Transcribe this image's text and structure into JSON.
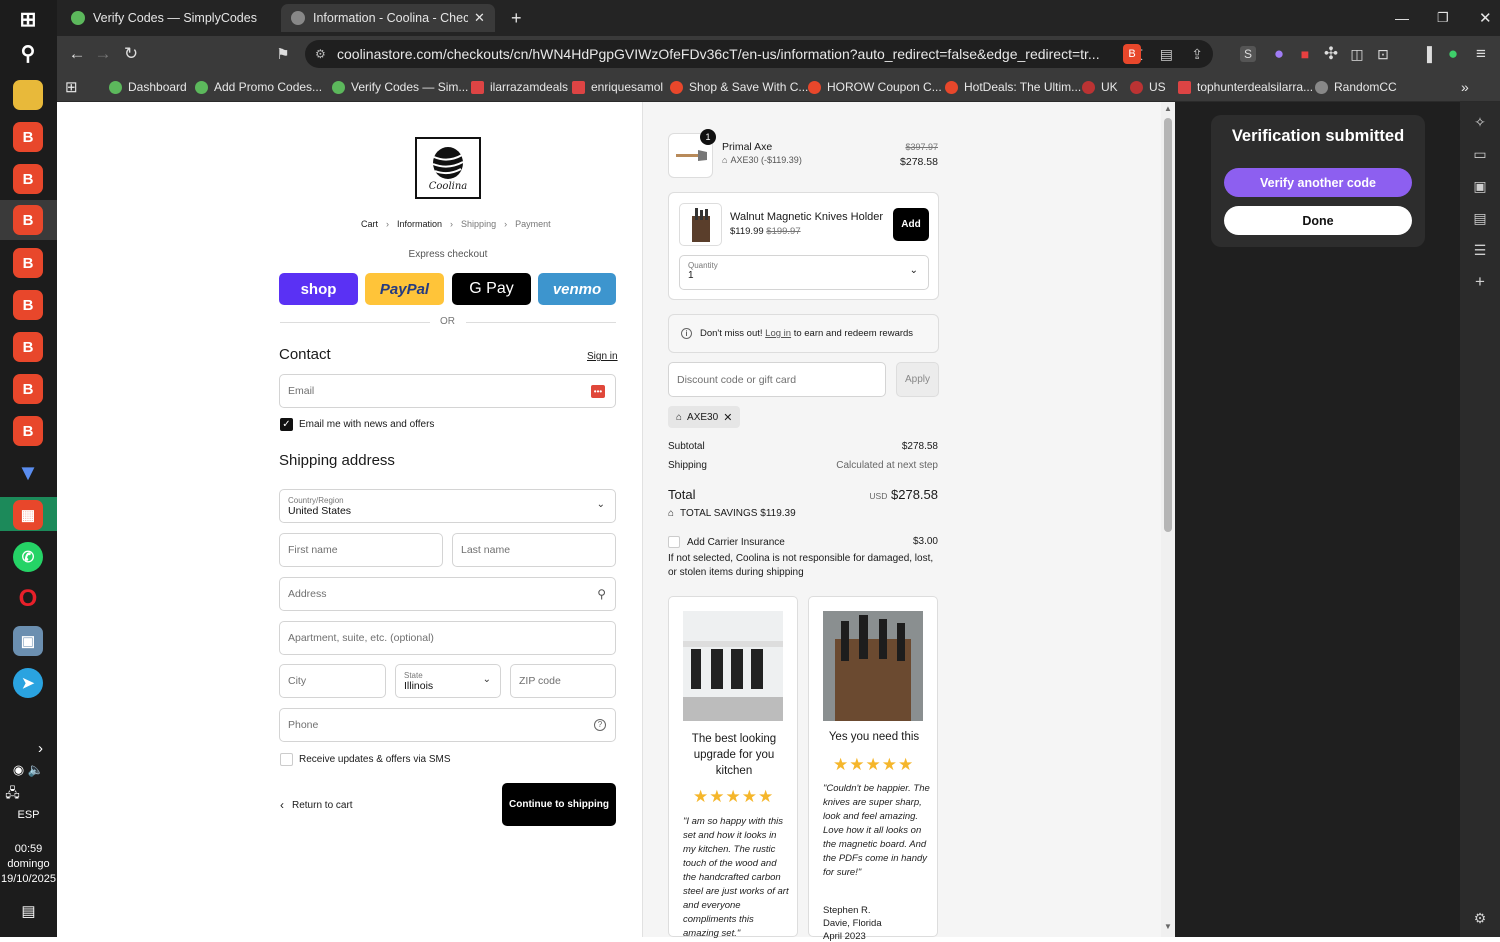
{
  "taskbar": {
    "lang": "ESP",
    "time": "00:59",
    "day": "domingo",
    "date": "19/10/2025"
  },
  "tabs": [
    {
      "title": "Verify Codes — SimplyCodes",
      "active": false
    },
    {
      "title": "Information - Coolina - Checkou",
      "active": true
    }
  ],
  "address": {
    "url": "coolinastore.com/checkouts/cn/hWN4HdPgpGVIWzOfeFDv36cT/en-us/information?auto_redirect=false&edge_redirect=tr..."
  },
  "bookmarks": [
    "Dashboard",
    "Add Promo Codes...",
    "Verify Codes — Sim...",
    "ilarrazamdeals",
    "enriquesamol",
    "Shop & Save With C...",
    "HOROW Coupon C...",
    "HotDeals: The Ultim...",
    "UK",
    "US",
    "tophunterdealsilarra...",
    "RandomCC"
  ],
  "checkout": {
    "logo_text": "Coolina",
    "breadcrumb": {
      "cart": "Cart",
      "information": "Information",
      "shipping": "Shipping",
      "payment": "Payment"
    },
    "express_label": "Express checkout",
    "pay_buttons": {
      "shop": "shop",
      "paypal": "PayPal",
      "gpay": "G Pay",
      "venmo": "venmo"
    },
    "or": "OR",
    "contact_title": "Contact",
    "sign_in": "Sign in",
    "email_placeholder": "Email",
    "email_news": "Email me with news and offers",
    "shipping_title": "Shipping address",
    "country_label": "Country/Region",
    "country_value": "United States",
    "first_name": "First name",
    "last_name": "Last name",
    "address": "Address",
    "apartment": "Apartment, suite, etc. (optional)",
    "city": "City",
    "state_label": "State",
    "state_value": "Illinois",
    "zip": "ZIP code",
    "phone": "Phone",
    "sms": "Receive updates & offers via SMS",
    "return": "Return to cart",
    "continue": "Continue to shipping"
  },
  "summary": {
    "item": {
      "qty_badge": "1",
      "name": "Primal Axe",
      "discount": "AXE30 (-$119.39)",
      "old_price": "$397.97",
      "price": "$278.58"
    },
    "upsell": {
      "name": "Walnut Magnetic Knives Holder",
      "price": "$119.99",
      "old_price": "$199.97",
      "add": "Add",
      "qty_label": "Quantity",
      "qty_value": "1"
    },
    "rewards": {
      "pre": "Don't miss out!",
      "link": "Log in",
      "post": "to earn and redeem rewards"
    },
    "discount_placeholder": "Discount code or gift card",
    "apply": "Apply",
    "code_tag": "AXE30",
    "subtotal_label": "Subtotal",
    "subtotal": "$278.58",
    "shipping_label": "Shipping",
    "shipping": "Calculated at next step",
    "total_label": "Total",
    "currency": "USD",
    "total": "$278.58",
    "savings": "TOTAL SAVINGS  $119.39",
    "insurance_label": "Add Carrier Insurance",
    "insurance_price": "$3.00",
    "insurance_note": "If not selected, Coolina is not responsible for damaged, lost, or stolen items during shipping",
    "reviews": [
      {
        "title": "The best looking upgrade for you kitchen",
        "stars": 5,
        "text": "\"I am so happy with this set and how it looks in my kitchen. The rustic touch of the wood and the handcrafted carbon steel are just works of art and everyone compliments this amazing set.\""
      },
      {
        "title": "Yes you need this",
        "stars": 5,
        "text": "\"Couldn't be happier. The knives are super sharp, look and feel amazing. Love how it all looks on the magnetic board. And the PDFs come in handy for sure!\"",
        "author": "Stephen R.",
        "location": "Davie, Florida",
        "date": "April 2023"
      }
    ]
  },
  "panel": {
    "title": "Verification submitted",
    "verify_another": "Verify another code",
    "done": "Done"
  }
}
